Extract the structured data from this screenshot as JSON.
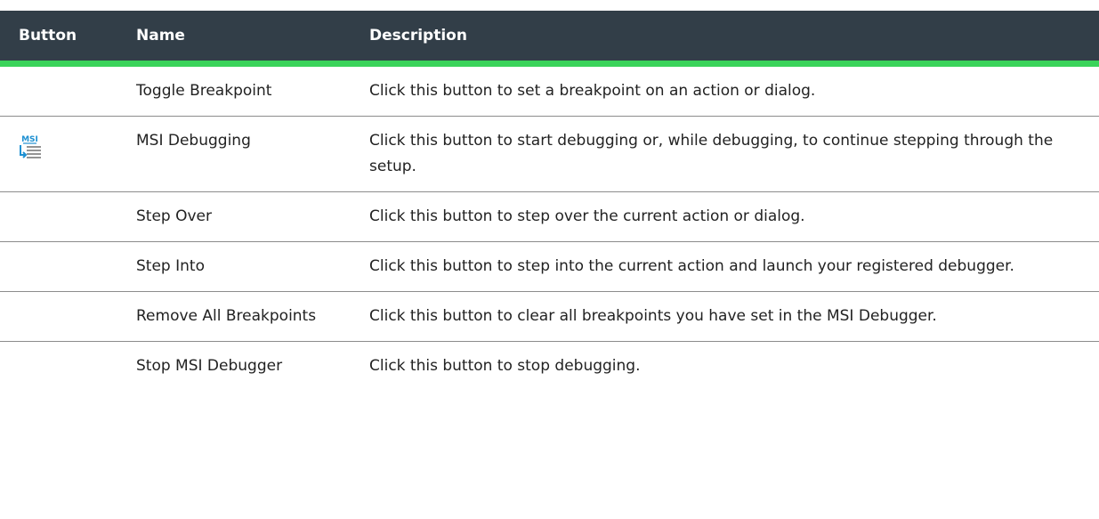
{
  "table": {
    "headers": {
      "button": "Button",
      "name": "Name",
      "description": "Description"
    },
    "rows": [
      {
        "icon": "",
        "name": "Toggle Breakpoint",
        "description": "Click this button to set a breakpoint on an action or dialog."
      },
      {
        "icon": "msi-debugging-icon",
        "name": "MSI Debugging",
        "description": "Click this button to start debugging or, while debugging, to continue stepping through the setup."
      },
      {
        "icon": "",
        "name": "Step Over",
        "description": "Click this button to step over the current action or dialog."
      },
      {
        "icon": "",
        "name": "Step Into",
        "description": "Click this button to step into the current action and launch your registered debugger."
      },
      {
        "icon": "",
        "name": "Remove All Breakpoints",
        "description": "Click this button to clear all breakpoints you have set in the MSI Debugger."
      },
      {
        "icon": "",
        "name": "Stop MSI Debugger",
        "description": "Click this button to stop debugging."
      }
    ],
    "icon_label": "MSI"
  },
  "colors": {
    "header_background": "#323e48",
    "header_text": "#ffffff",
    "header_accent": "#3ad35a",
    "icon_blue": "#1e90d2",
    "icon_gray": "#7a7a7a"
  }
}
